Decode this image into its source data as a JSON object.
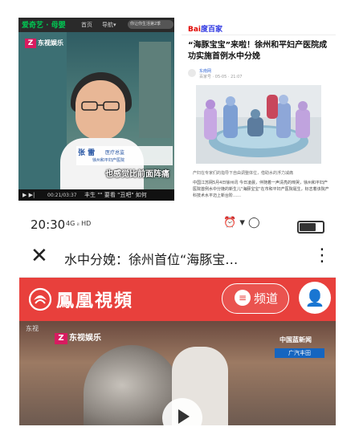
{
  "panel1": {
    "logo": "爱奇艺 · 母婴",
    "nav": [
      "首页",
      "导航▾"
    ],
    "search_placeholder": "你让你生活第2季",
    "channel_logo": "东视娱乐",
    "name": "张 雷",
    "role": "医疗总监",
    "org": "徐州和平妇产医院",
    "subtitle": "也感觉比前面阵痛",
    "play_icon": "play-icon",
    "time": "00:21/03:37",
    "bottom_text": "丰生   \"\"   要看  \"丑吧\"  如何"
  },
  "panel2": {
    "brand_left": "Bai",
    "brand_right": "度百家",
    "title": "“海豚宝宝”来啦！徐州和平妇产医院成功实施首例水中分娩",
    "source": "东南网",
    "source_date": "百家号 · 05-05 · 21:07",
    "caption": "产妇在专家们的指导下自由调整体位，借助水的浮力减痛",
    "body": "中国江苏网5月4日徐州讯 今日凌晨，伴随着一声清亮的啼哭，徐州和平妇产医院首例水中分娩的新生儿\"海豚宝宝\"在市和平妇产医院诞生，标志着该院产科技术水平迈上新台阶……"
  },
  "panel3": {
    "clock": "20:30",
    "signal": "4G ᵢₗ HD",
    "status_right": "⏰ ▾ ◯",
    "close_icon": "close-icon",
    "nav_title": "水中分娩：徐州首位“海豚宝…",
    "more_icon": "more-vertical-icon",
    "brand": "鳳凰視頻",
    "channel_label": "频道",
    "channel_icon": "menu-icon",
    "user_icon": "user-icon",
    "video_logo": "东视娱乐",
    "corner_text": "中国蓝新闻",
    "corner_badge": "广汽丰田",
    "video_play_icon": "play-icon",
    "streak": "东视"
  },
  "colors": {
    "phoenix_red": "#e8403c",
    "iqiyi_green": "#00c853",
    "baidu_blue": "#2932e1"
  }
}
